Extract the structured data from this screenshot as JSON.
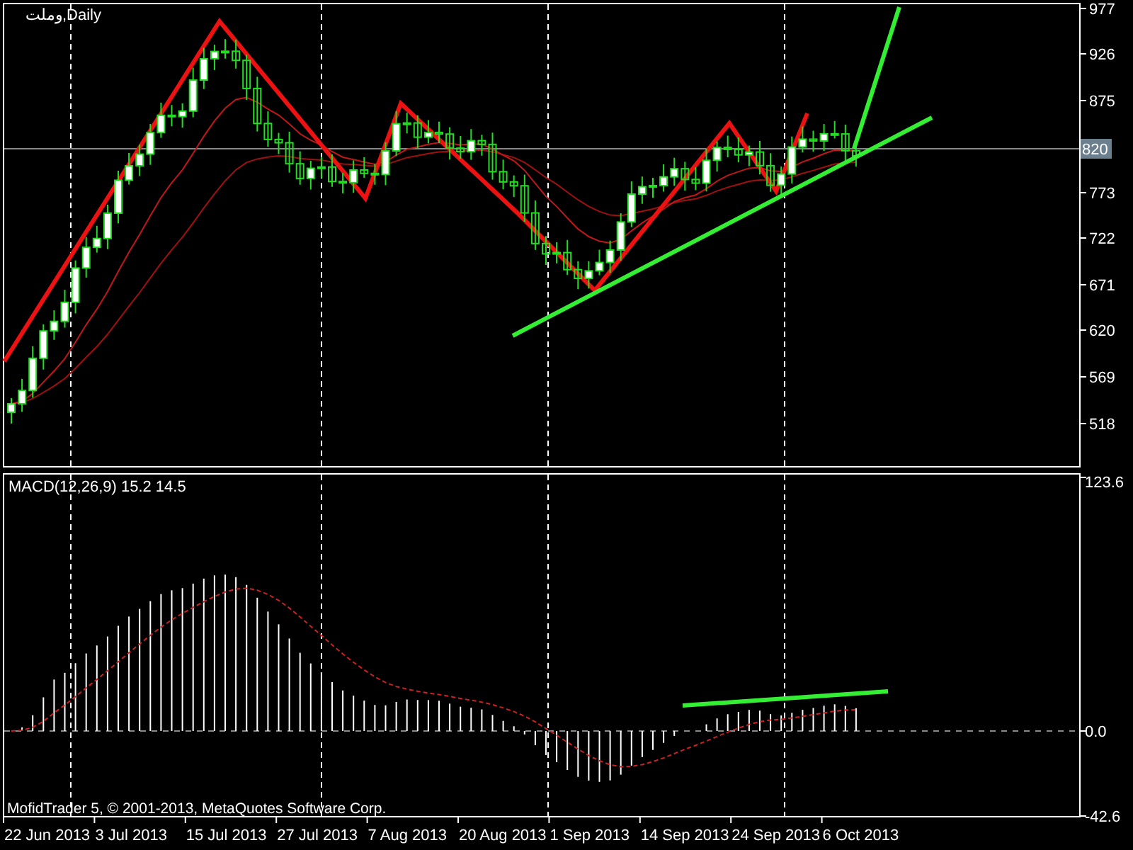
{
  "chart": {
    "title": "وملت,Daily",
    "price_axis": [
      "977",
      "926",
      "875",
      "773",
      "722",
      "671",
      "620",
      "569",
      "518"
    ],
    "current_price": "820",
    "indicator": {
      "label": "MACD(12,26,9) 15.2 14.5",
      "axis": [
        "123.6",
        "0.0",
        "-42.6"
      ]
    },
    "copyright": "MofidTrader 5, © 2001-2013, MetaQuotes Software Corp.",
    "time_axis": [
      "22 Jun 2013",
      "3 Jul 2013",
      "15 Jul 2013",
      "27 Jul 2013",
      "7 Aug 2013",
      "20 Aug 2013",
      "1 Sep 2013",
      "14 Sep 2013",
      "24 Sep 2013",
      "6 Oct 2013"
    ]
  }
}
